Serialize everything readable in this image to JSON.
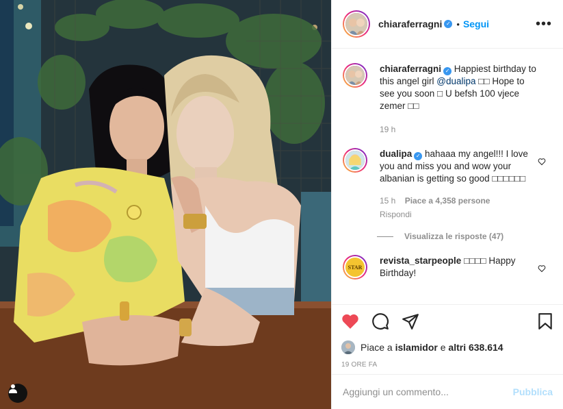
{
  "post": {
    "author": "chiaraferragni",
    "follow_label": "Segui",
    "more_icon": "more-horizontal-icon",
    "caption_user": "chiaraferragni",
    "caption_text_before": " Happiest birthday to this angel girl ",
    "caption_mention": "@dualipa",
    "caption_text_after": " □□ Hope to see you soon □ U befsh 100 vjece zemer □□",
    "caption_time": "19 h"
  },
  "comments": [
    {
      "user": "dualipa",
      "verified": true,
      "text": " hahaaa my angel!!! I love you and miss you and wow your albanian is getting so good □□□□□□",
      "time": "15 h",
      "likes": "Piace a 4,358 persone",
      "reply": "Rispondi",
      "view_replies": "Visualizza le risposte (47)"
    },
    {
      "user": "revista_starpeople",
      "verified": false,
      "text": " □□□□ Happy Birthday!",
      "avatar_text": "STAR"
    }
  ],
  "actions": {
    "like_icon": "heart-filled-icon",
    "comment_icon": "comment-icon",
    "share_icon": "share-icon",
    "save_icon": "bookmark-icon",
    "liked_color": "#ed4956"
  },
  "likes": {
    "prefix": "Piace a ",
    "user": "islamidor",
    "middle": " e ",
    "others": "altri 638.614"
  },
  "timestamp": "19 ORE FA",
  "add_comment": {
    "placeholder": "Aggiungi un commento...",
    "publish_label": "Pubblica"
  },
  "colors": {
    "accent": "#0095f6",
    "publish_disabled": "#b2dffc",
    "muted": "#8e8e8e"
  }
}
